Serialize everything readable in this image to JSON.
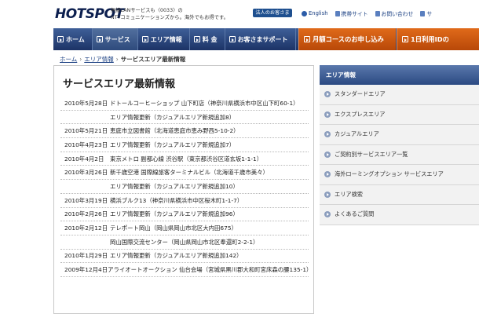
{
  "header": {
    "logo_text": "HOTSPOT",
    "tagline_1": "無線LANサービスも〈0033〉の",
    "tagline_2": "NTTコミュニケーションズから。海外でもお得です。",
    "corporate_button": "法人のお客さま",
    "links": [
      {
        "label": "English",
        "icon": "globe-icon"
      },
      {
        "label": "携帯サイト",
        "icon": "mobile-icon"
      },
      {
        "label": "お問い合わせ",
        "icon": "mail-icon"
      },
      {
        "label": "サ",
        "icon": "sitemap-icon"
      }
    ]
  },
  "nav": {
    "items": [
      {
        "label": "ホーム"
      },
      {
        "label": "サービス"
      },
      {
        "label": "エリア情報"
      },
      {
        "label": "料 金"
      },
      {
        "label": "お客さまサポート"
      }
    ],
    "orange_items": [
      {
        "label": "月額コースのお申し込み"
      },
      {
        "label": "1日利用IDの"
      }
    ]
  },
  "breadcrumb": {
    "home": "ホーム",
    "area": "エリア情報",
    "separator": "›",
    "current": "サービスエリア最新情報"
  },
  "main": {
    "title": "サービスエリア最新情報",
    "rows": [
      {
        "date": "2010年5月28日",
        "text": "ドトールコーヒーショップ 山下町店（神奈川県横浜市中区山下町60-1）"
      },
      {
        "date": "",
        "text": "エリア情報更新（カジュアルエリア新規追加8）"
      },
      {
        "date": "2010年5月21日",
        "text": "恵庭市立図書館（北海道恵庭市恵み野西5-10-2）"
      },
      {
        "date": "2010年4月23日",
        "text": "エリア情報更新（カジュアルエリア新規追加7）"
      },
      {
        "date": "2010年4月2日",
        "text": "東京メトロ 副都心線 渋谷駅（東京都渋谷区道玄坂1-1-1）"
      },
      {
        "date": "2010年3月26日",
        "text": "新千歳空港 国際線旅客ターミナルビル（北海道千歳市美々）"
      },
      {
        "date": "",
        "text": "エリア情報更新（カジュアルエリア新規追加10）"
      },
      {
        "date": "2010年3月19日",
        "text": "横浜ブルク13（神奈川県横浜市中区桜木町1-1-7）"
      },
      {
        "date": "2010年2月26日",
        "text": "エリア情報更新（カジュアルエリア新規追加96）"
      },
      {
        "date": "2010年2月12日",
        "text": "テレポート岡山（岡山県岡山市北区大内田675）"
      },
      {
        "date": "",
        "text": "岡山国際交流センター（岡山県岡山市北区奉還町2-2-1）"
      },
      {
        "date": "2010年1月29日",
        "text": "エリア情報更新（カジュアルエリア新規追加142）"
      },
      {
        "date": "2009年12月4日",
        "text": "アライオートオークション 仙台会場（宮城県黒川郡大和町宮床森の腰135-1）"
      }
    ]
  },
  "sidebar": {
    "heading": "エリア情報",
    "items": [
      {
        "label": "スタンダードエリア"
      },
      {
        "label": "エクスプレスエリア"
      },
      {
        "label": "カジュアルエリア"
      },
      {
        "label": "ご契約別サービスエリア一覧"
      },
      {
        "label": "海外ローミングオプション サービスエリア"
      },
      {
        "label": "エリア検索"
      },
      {
        "label": "よくあるご質問"
      }
    ]
  },
  "colors": {
    "nav_blue": "#1c3366",
    "nav_orange": "#c85510",
    "link_blue": "#1a3f82",
    "sidebar_bg": "#f2f2f2"
  }
}
